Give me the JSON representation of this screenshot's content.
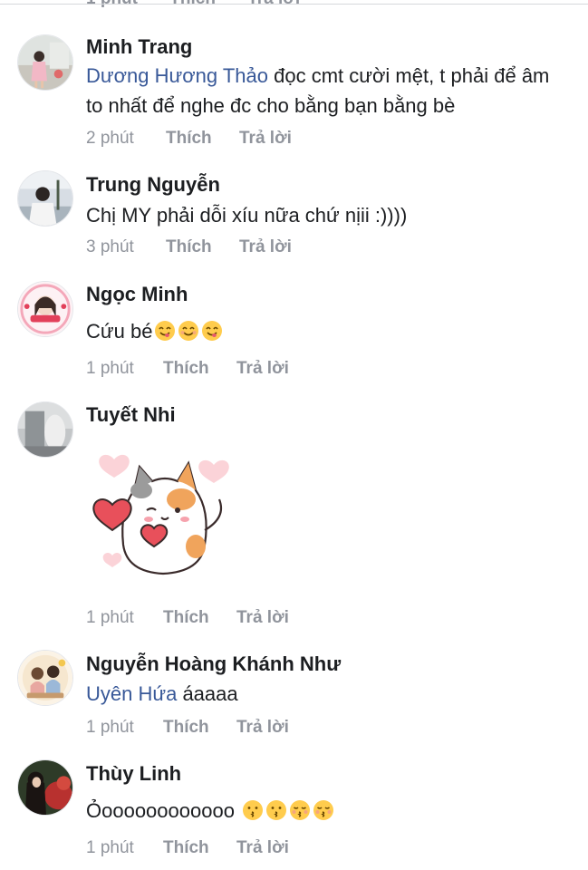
{
  "top_partial": {
    "time": "1 phút",
    "like": "Thích",
    "reply": "Trả lời"
  },
  "comments": [
    {
      "author": "Minh Trang",
      "mention": "Dương Hương Thảo",
      "text": " đọc cmt cười mệt, t phải để âm to nhất để nghe đc cho bằng bạn bằng bè",
      "time": "2 phút",
      "like": "Thích",
      "reply": "Trả lời"
    },
    {
      "author": "Trung Nguyễn",
      "text": "Chị MY phải dỗi xíu nữa chứ nịii :))))",
      "time": "3 phút",
      "like": "Thích",
      "reply": "Trả lời"
    },
    {
      "author": "Ngọc Minh",
      "text": "Cứu bé",
      "emojis": [
        "yum-face",
        "smile-face",
        "yum-face"
      ],
      "time": "1 phút",
      "like": "Thích",
      "reply": "Trả lời"
    },
    {
      "author": "Tuyết Nhi",
      "sticker": "cat-with-hearts-sticker",
      "time": "1 phút",
      "like": "Thích",
      "reply": "Trả lời"
    },
    {
      "author": "Nguyễn Hoàng Khánh Như",
      "mention": "Uyên Hứa",
      "text": " áaaaa",
      "time": "1 phút",
      "like": "Thích",
      "reply": "Trả lời"
    },
    {
      "author": "Thùy Linh",
      "text": "Ỏoooooooooooo",
      "emojis": [
        "kiss-face",
        "kiss-face",
        "kiss-closed-eyes-face",
        "kiss-closed-eyes-face"
      ],
      "time": "1 phút",
      "like": "Thích",
      "reply": "Trả lời"
    }
  ],
  "colors": {
    "link": "#385898",
    "meta": "#90949c",
    "text": "#1c1e21",
    "emoji": "#ffcc4d"
  }
}
